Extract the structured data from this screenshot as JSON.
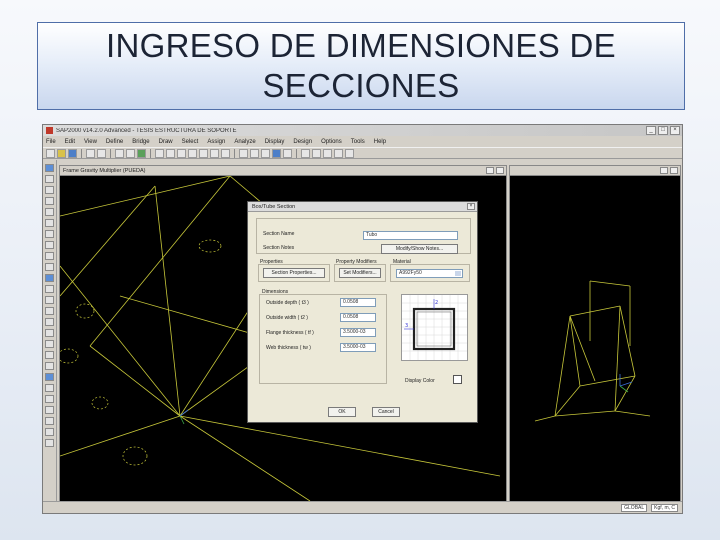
{
  "slide": {
    "title_line1": "INGRESO DE DIMENSIONES DE",
    "title_line2": "SECCIONES"
  },
  "app": {
    "window_title": "SAP2000 v14.2.0 Advanced - TESIS ESTRUCTURA DE SOPORTE",
    "menu": [
      "File",
      "Edit",
      "View",
      "Define",
      "Bridge",
      "Draw",
      "Select",
      "Assign",
      "Analyze",
      "Display",
      "Design",
      "Options",
      "Tools",
      "Help"
    ],
    "left_view_title": "Frame Gravity Multiplier (PUEDA)",
    "status": {
      "units": "GLOBAL",
      "coord": "Kgf, m, C"
    }
  },
  "dialog": {
    "title": "Box/Tube Section",
    "section_name_label": "Section Name",
    "section_name_value": "Tubo",
    "section_notes_label": "Section Notes",
    "modify_notes_button": "Modify/Show Notes...",
    "properties_label": "Properties",
    "section_properties_button": "Section Properties...",
    "property_modifiers_label": "Property Modifiers",
    "set_modifiers_button": "Set Modifiers...",
    "material_label": "Material",
    "material_value": "A992Fy50",
    "dimensions_label": "Dimensions",
    "fields": [
      {
        "label": "Outside depth  ( t3 )",
        "value": "0.0508"
      },
      {
        "label": "Outside width  ( t2 )",
        "value": "0.0508"
      },
      {
        "label": "Flange thickness  ( tf )",
        "value": "3.5000-03"
      },
      {
        "label": "Web thickness  ( tw )",
        "value": "3.5000-03"
      }
    ],
    "preview_axis_2": "2",
    "preview_axis_3": "3",
    "display_color_label": "Display Color",
    "ok_button": "OK",
    "cancel_button": "Cancel"
  },
  "colors": {
    "title_border": "#4f6ea8",
    "model_lines": "#c8c83a",
    "model_labels": "#d8d84a",
    "axis_blue": "#3a6fd8",
    "axis_green": "#3fae4a"
  }
}
